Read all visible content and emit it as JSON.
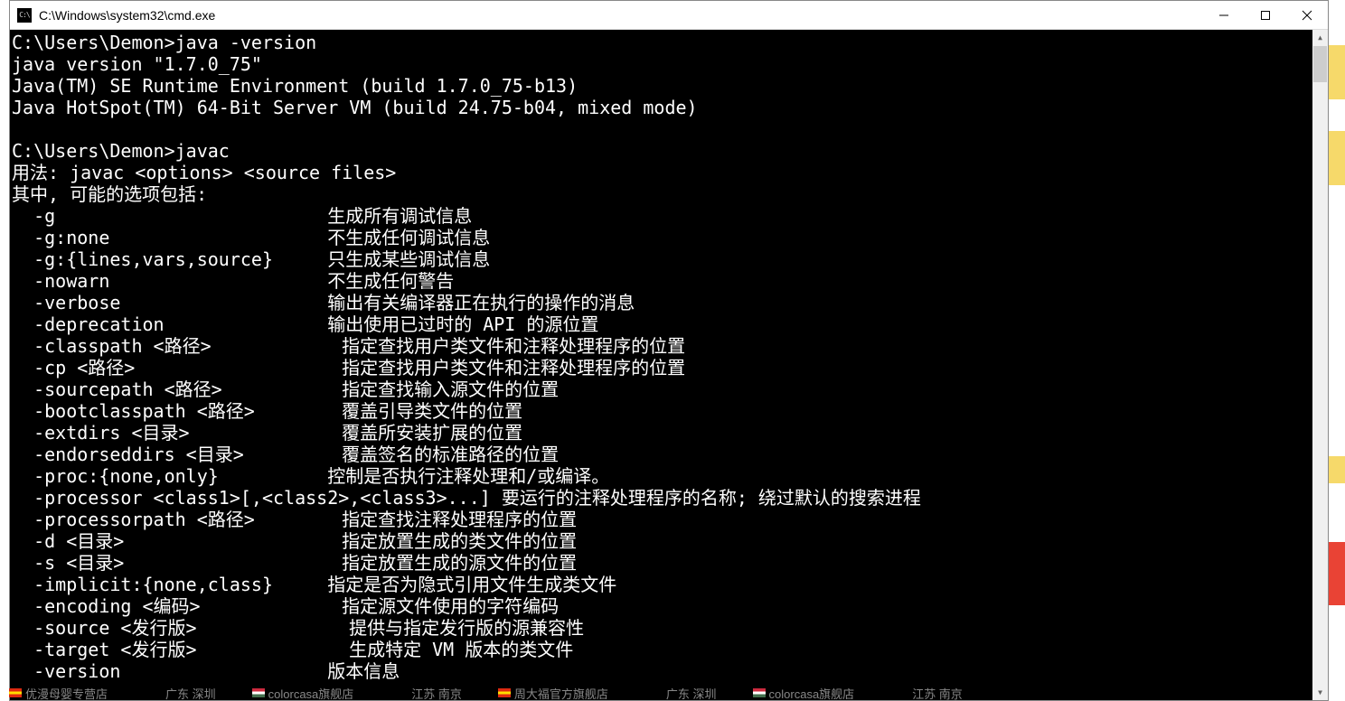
{
  "window": {
    "title": "C:\\Windows\\system32\\cmd.exe",
    "icon_label": "C:\\"
  },
  "terminal": {
    "lines": [
      "C:\\Users\\Demon>java -version",
      "java version \"1.7.0_75\"",
      "Java(TM) SE Runtime Environment (build 1.7.0_75-b13)",
      "Java HotSpot(TM) 64-Bit Server VM (build 24.75-b04, mixed mode)",
      "",
      "C:\\Users\\Demon>javac",
      "用法: javac <options> <source files>",
      "其中, 可能的选项包括:",
      "  -g                         生成所有调试信息",
      "  -g:none                    不生成任何调试信息",
      "  -g:{lines,vars,source}     只生成某些调试信息",
      "  -nowarn                    不生成任何警告",
      "  -verbose                   输出有关编译器正在执行的操作的消息",
      "  -deprecation               输出使用已过时的 API 的源位置",
      "  -classpath <路径>            指定查找用户类文件和注释处理程序的位置",
      "  -cp <路径>                   指定查找用户类文件和注释处理程序的位置",
      "  -sourcepath <路径>           指定查找输入源文件的位置",
      "  -bootclasspath <路径>        覆盖引导类文件的位置",
      "  -extdirs <目录>              覆盖所安装扩展的位置",
      "  -endorseddirs <目录>         覆盖签名的标准路径的位置",
      "  -proc:{none,only}          控制是否执行注释处理和/或编译。",
      "  -processor <class1>[,<class2>,<class3>...] 要运行的注释处理程序的名称; 绕过默认的搜索进程",
      "  -processorpath <路径>        指定查找注释处理程序的位置",
      "  -d <目录>                    指定放置生成的类文件的位置",
      "  -s <目录>                    指定放置生成的源文件的位置",
      "  -implicit:{none,class}     指定是否为隐式引用文件生成类文件",
      "  -encoding <编码>             指定源文件使用的字符编码",
      "  -source <发行版>              提供与指定发行版的源兼容性",
      "  -target <发行版>              生成特定 VM 版本的类文件",
      "  -version                   版本信息"
    ]
  },
  "bottom": {
    "items": [
      {
        "flag": "cn",
        "name": "优漫母婴专营店",
        "loc": "广东 深圳"
      },
      {
        "flag": "hu",
        "name": "colorcasa旗舰店",
        "loc": "江苏 南京"
      },
      {
        "flag": "cn",
        "name": "周大福官方旗舰店",
        "loc": "广东 深圳"
      },
      {
        "flag": "hu",
        "name": "colorcasa旗舰店",
        "loc": "江苏 南京"
      }
    ]
  }
}
